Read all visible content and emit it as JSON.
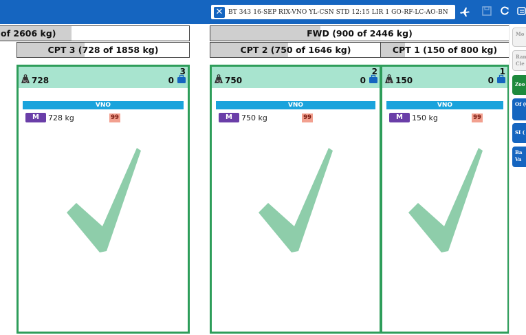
{
  "topbar": {
    "flight_info": "BT 343   16-SEP   RIX-VNO   YL-CSN   STD 12:15   LIR 1   GO-RF-LC-AO-BN",
    "icons": [
      "close-icon",
      "plane-icon",
      "save-icon",
      "refresh-icon",
      "menu-icon"
    ],
    "color": "#1565c0"
  },
  "holds": [
    {
      "label": "of 2606 kg)"
    },
    {
      "label": "FWD (900 of 2446 kg)"
    }
  ],
  "compartments": [
    {
      "label": "CPT 3 (728 of 1858 kg)",
      "number": "3",
      "weight": "728",
      "bag_count": "0",
      "destination": "VNO",
      "uld_type": "M",
      "item_weight": "728 kg",
      "code": "99",
      "fill_fraction": 0.39
    },
    {
      "label": "CPT 2 (750 of 1646 kg)",
      "number": "2",
      "weight": "750",
      "bag_count": "0",
      "destination": "VNO",
      "uld_type": "M",
      "item_weight": "750 kg",
      "code": "99",
      "fill_fraction": 0.456
    },
    {
      "label": "CPT 1 (150 of 800 kg)",
      "number": "1",
      "weight": "150",
      "bag_count": "0",
      "destination": "VNO",
      "uld_type": "M",
      "item_weight": "150 kg",
      "code": "99",
      "fill_fraction": 0.1875
    }
  ],
  "hold_fill": {
    "aft": 0.38,
    "fwd": 0.368
  },
  "side_buttons": [
    {
      "label": "Mo",
      "style": "grey"
    },
    {
      "label": "Ran Cle",
      "style": "grey"
    },
    {
      "label": "Zoo",
      "style": "green"
    },
    {
      "label": "Of (0",
      "style": "blue"
    },
    {
      "label": "SI (",
      "style": "blue"
    },
    {
      "label": "Ba Va",
      "style": "blue"
    }
  ],
  "colors": {
    "panel_border": "#2e9d5a",
    "panel_header": "#a8e4cf",
    "destination": "#1aa3dc",
    "uld_badge": "#6a3ea8",
    "code_badge": "#f2a08f",
    "check": "#8ecdaa"
  }
}
